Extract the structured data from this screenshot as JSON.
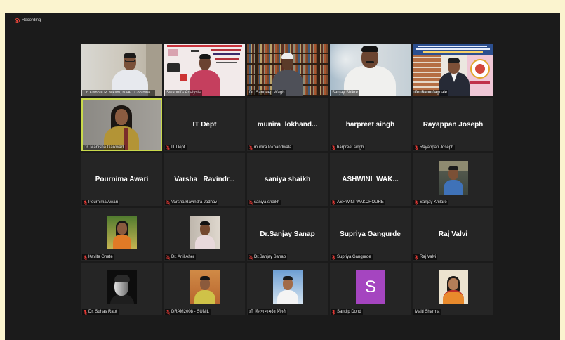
{
  "window": {
    "recording_label": "Recording"
  },
  "icons": {
    "recording": "recording-dot-icon",
    "muted": "muted-mic-icon"
  },
  "colors": {
    "frame": "#fbf4cf",
    "window_bg": "#1b1b1b",
    "tile_bg": "#252525",
    "active_speaker": "#c9d94c",
    "muted_icon": "#e53935",
    "letter_avatar": "#a545c0",
    "recording": "#e5453a"
  },
  "participants": [
    {
      "label": "Dr. Kishore R. Nikam, NAAC Coordina...",
      "muted": false
    },
    {
      "label": "Swapnil's Analysis",
      "muted": false
    },
    {
      "label": "Dr. Sandeep Wagh",
      "muted": false
    },
    {
      "label": "Sanjay Shikre",
      "muted": false
    },
    {
      "label": "Dr. Bapu Jagdale",
      "muted": false
    },
    {
      "label": "Dr. Manisha Gaikwad",
      "muted": false,
      "active_speaker": true
    },
    {
      "label": "IT Dept",
      "display_name": "IT Dept",
      "muted": true
    },
    {
      "label": "munira lokhandwala",
      "display_name": "munira  lokhand...",
      "muted": true
    },
    {
      "label": "harpreet singh",
      "display_name": "harpreet singh",
      "muted": true
    },
    {
      "label": "Rayappan Joseph",
      "display_name": "Rayappan Joseph",
      "muted": true
    },
    {
      "label": "Pournima Awari",
      "display_name": "Pournima Awari",
      "muted": true
    },
    {
      "label": "Varsha Ravindra Jadhav",
      "display_name": "Varsha   Ravindr...",
      "muted": true
    },
    {
      "label": "saniya shaikh",
      "display_name": "saniya shaikh",
      "muted": true
    },
    {
      "label": "ASHWINI WAKCHOURE",
      "display_name": "ASHWINI  WAK...",
      "muted": true
    },
    {
      "label": "Sanjay Khilare",
      "muted": true
    },
    {
      "label": "Kavita Ghate",
      "muted": true
    },
    {
      "label": "Dr. Anil Aher",
      "muted": true
    },
    {
      "label": "Dr.Sanjay Sanap",
      "display_name": "Dr.Sanjay Sanap",
      "muted": true
    },
    {
      "label": "Supriya Gangurde",
      "display_name": "Supriya Gangurde",
      "muted": true
    },
    {
      "label": "Raj Valvi",
      "display_name": "Raj Valvi",
      "muted": true
    },
    {
      "label": "Dr. Suhas Raut",
      "muted": true
    },
    {
      "label": "DRAM2008 - SUNIL",
      "muted": true
    },
    {
      "label": "डॉ. किरण नामदेव शिंगते",
      "muted": false
    },
    {
      "label": "Sandip Dond",
      "avatar_letter": "S",
      "muted": true
    },
    {
      "label": "Malti Sharma",
      "muted": false
    }
  ]
}
